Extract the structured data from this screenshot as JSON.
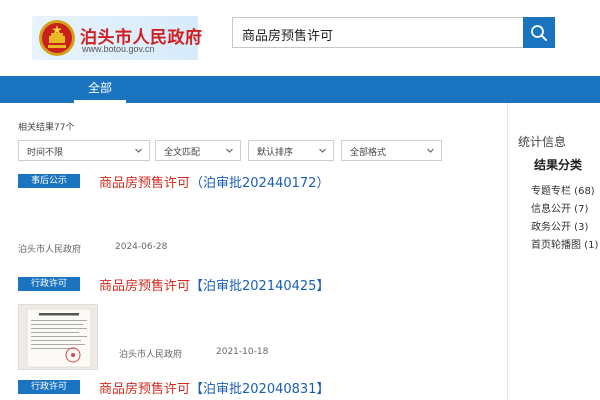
{
  "header": {
    "site_name": "泊头市人民政府",
    "site_url": "www.botou.gov.cn",
    "emblem_icon": "national-emblem-icon",
    "search_value": "商品房预售许可",
    "search_icon": "search-icon"
  },
  "nav": {
    "tabs": [
      {
        "label": "全部"
      }
    ]
  },
  "results_meta": {
    "count_text": "相关结果77个",
    "filters": [
      {
        "label": "时间不限"
      },
      {
        "label": "全文匹配"
      },
      {
        "label": "默认排序"
      },
      {
        "label": "全部格式"
      }
    ]
  },
  "results": [
    {
      "badge": "事后公示",
      "title_main": "商品房预售许可",
      "title_code": "（泊审批202440172）",
      "source": "泊头市人民政府",
      "date": "2024-06-28"
    },
    {
      "badge": "行政许可",
      "title_main": "商品房预售许可",
      "title_code": "【泊审批202140425】",
      "source": "泊头市人民政府",
      "date": "2021-10-18"
    },
    {
      "badge": "行政许可",
      "title_main": "商品房预售许可",
      "title_code": "【泊审批202040831】"
    }
  ],
  "sidebar": {
    "title": "统计信息",
    "subtitle": "结果分类",
    "items": [
      {
        "label": "专题专栏 (68)"
      },
      {
        "label": "信息公开 (7)"
      },
      {
        "label": "政务公开 (3)"
      },
      {
        "label": "首页轮播图 (1)"
      }
    ]
  },
  "colors": {
    "brand_blue": "#1a74bf",
    "title_red": "#d12b1f",
    "title_blue": "#1a5fb4"
  }
}
